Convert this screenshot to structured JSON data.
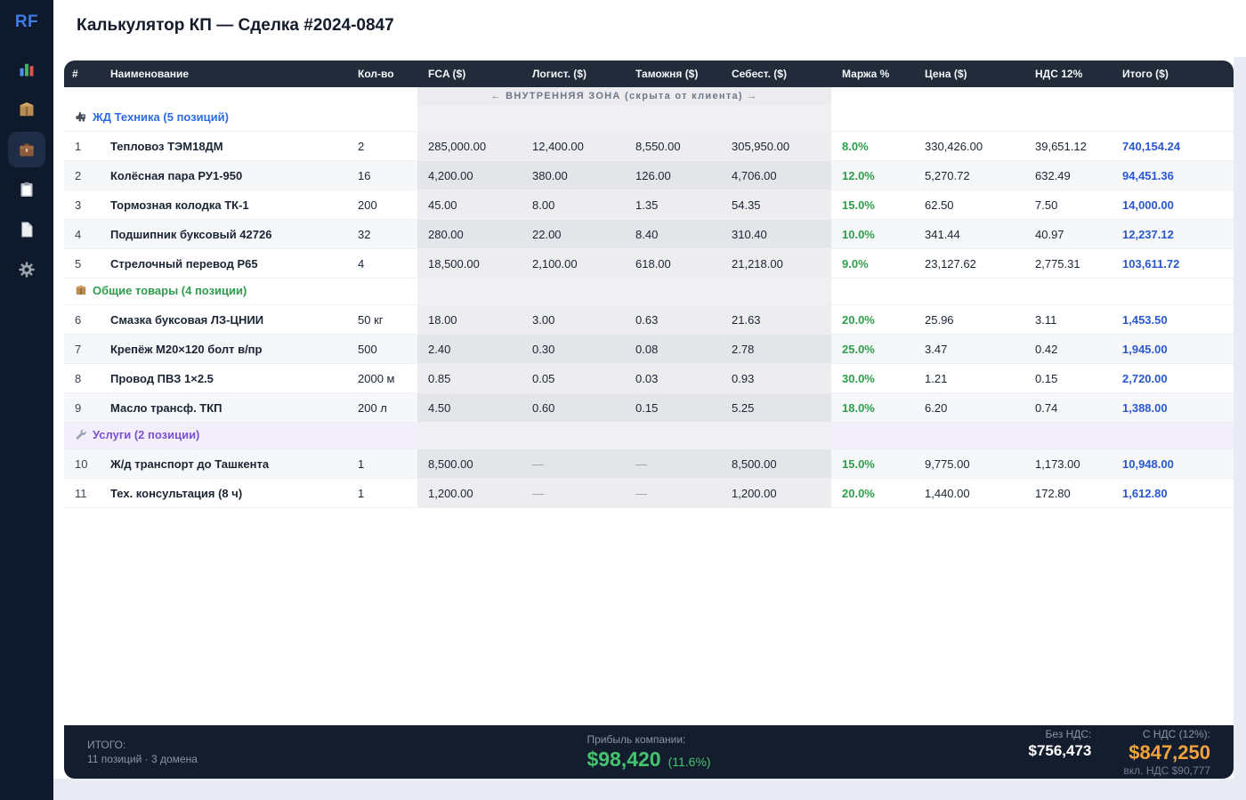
{
  "sidebar": {
    "logo": "RF",
    "items": [
      {
        "name": "analytics",
        "icon": "bar-chart-icon",
        "active": false
      },
      {
        "name": "products",
        "icon": "package-icon",
        "active": false
      },
      {
        "name": "deals",
        "icon": "briefcase-icon",
        "active": true
      },
      {
        "name": "orders",
        "icon": "clipboard-icon",
        "active": false
      },
      {
        "name": "documents",
        "icon": "document-icon",
        "active": false
      },
      {
        "name": "settings",
        "icon": "gear-icon",
        "active": false
      }
    ]
  },
  "header": {
    "title": "Калькулятор КП — Сделка #2024-0847"
  },
  "table": {
    "columns": [
      "#",
      "Наименование",
      "Кол-во",
      "FCA ($)",
      "Логист. ($)",
      "Таможня ($)",
      "Себест. ($)",
      "Маржа %",
      "Цена ($)",
      "НДС 12%",
      "Итого ($)"
    ],
    "internal_zone_label": "← ВНУТРЕННЯЯ ЗОНА (скрыта от клиента) →",
    "rows": [
      {
        "type": "group",
        "key": "rail",
        "icon": "train-icon",
        "label": "ЖД Техника (5 позиций)"
      },
      {
        "type": "item",
        "num": "1",
        "name": "Тепловоз ТЭМ18ДМ",
        "qty": "2",
        "fca": "285,000.00",
        "logistics": "12,400.00",
        "customs": "8,550.00",
        "cost": "305,950.00",
        "margin": "8.0%",
        "price": "330,426.00",
        "vat": "39,651.12",
        "total": "740,154.24"
      },
      {
        "type": "item",
        "num": "2",
        "name": "Колёсная пара РУ1-950",
        "qty": "16",
        "fca": "4,200.00",
        "logistics": "380.00",
        "customs": "126.00",
        "cost": "4,706.00",
        "margin": "12.0%",
        "price": "5,270.72",
        "vat": "632.49",
        "total": "94,451.36"
      },
      {
        "type": "item",
        "num": "3",
        "name": "Тормозная колодка ТК-1",
        "qty": "200",
        "fca": "45.00",
        "logistics": "8.00",
        "customs": "1.35",
        "cost": "54.35",
        "margin": "15.0%",
        "price": "62.50",
        "vat": "7.50",
        "total": "14,000.00"
      },
      {
        "type": "item",
        "num": "4",
        "name": "Подшипник буксовый 42726",
        "qty": "32",
        "fca": "280.00",
        "logistics": "22.00",
        "customs": "8.40",
        "cost": "310.40",
        "margin": "10.0%",
        "price": "341.44",
        "vat": "40.97",
        "total": "12,237.12"
      },
      {
        "type": "item",
        "num": "5",
        "name": "Стрелочный перевод Р65",
        "qty": "4",
        "fca": "18,500.00",
        "logistics": "2,100.00",
        "customs": "618.00",
        "cost": "21,218.00",
        "margin": "9.0%",
        "price": "23,127.62",
        "vat": "2,775.31",
        "total": "103,611.72"
      },
      {
        "type": "group",
        "key": "goods",
        "icon": "package-icon",
        "label": "Общие товары (4 позиции)"
      },
      {
        "type": "item",
        "num": "6",
        "name": "Смазка буксовая ЛЗ-ЦНИИ",
        "qty": "50 кг",
        "fca": "18.00",
        "logistics": "3.00",
        "customs": "0.63",
        "cost": "21.63",
        "margin": "20.0%",
        "price": "25.96",
        "vat": "3.11",
        "total": "1,453.50"
      },
      {
        "type": "item",
        "num": "7",
        "name": "Крепёж М20×120 болт в/пр",
        "qty": "500",
        "fca": "2.40",
        "logistics": "0.30",
        "customs": "0.08",
        "cost": "2.78",
        "margin": "25.0%",
        "price": "3.47",
        "vat": "0.42",
        "total": "1,945.00"
      },
      {
        "type": "item",
        "num": "8",
        "name": "Провод ПВЗ 1×2.5",
        "qty": "2000 м",
        "fca": "0.85",
        "logistics": "0.05",
        "customs": "0.03",
        "cost": "0.93",
        "margin": "30.0%",
        "price": "1.21",
        "vat": "0.15",
        "total": "2,720.00"
      },
      {
        "type": "item",
        "num": "9",
        "name": "Масло трансф. ТКП",
        "qty": "200 л",
        "fca": "4.50",
        "logistics": "0.60",
        "customs": "0.15",
        "cost": "5.25",
        "margin": "18.0%",
        "price": "6.20",
        "vat": "0.74",
        "total": "1,388.00"
      },
      {
        "type": "group",
        "key": "services",
        "icon": "wrench-icon",
        "label": "Услуги (2 позиции)"
      },
      {
        "type": "item",
        "num": "10",
        "name": "Ж/д транспорт до Ташкента",
        "qty": "1",
        "fca": "8,500.00",
        "logistics": "—",
        "customs": "—",
        "cost": "8,500.00",
        "margin": "15.0%",
        "price": "9,775.00",
        "vat": "1,173.00",
        "total": "10,948.00"
      },
      {
        "type": "item",
        "num": "11",
        "name": "Тех. консультация (8 ч)",
        "qty": "1",
        "fca": "1,200.00",
        "logistics": "—",
        "customs": "—",
        "cost": "1,200.00",
        "margin": "20.0%",
        "price": "1,440.00",
        "vat": "172.80",
        "total": "1,612.80"
      }
    ]
  },
  "footer": {
    "total_label": "ИТОГО:",
    "total_sub": "11 позиций · 3 домена",
    "profit_label": "Прибыль компании:",
    "profit_value": "$98,420",
    "profit_pct": "(11.6%)",
    "net_label": "Без НДС:",
    "net_value": "$756,473",
    "gross_label": "С НДС (12%):",
    "gross_value": "$847,250",
    "gross_sub": "вкл. НДС $90,777"
  },
  "colors": {
    "sidebar_bg": "#0e1a2b",
    "table_head_bg": "#212b3a",
    "footer_bg": "#141d2d",
    "group_rail": "#2e6be6",
    "group_goods": "#2f9e4c",
    "group_services": "#7b52d1",
    "margin_green": "#2f9e4c",
    "total_blue": "#2a58d0",
    "profit_green": "#45c46e",
    "gross_orange": "#f0a23c",
    "logo_blue": "#3f7ce8"
  }
}
